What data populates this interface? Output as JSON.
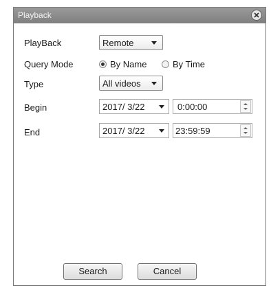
{
  "window": {
    "title": "Playback"
  },
  "form": {
    "playback": {
      "label": "PlayBack",
      "value": "Remote"
    },
    "query_mode": {
      "label": "Query Mode",
      "options": [
        {
          "label": "By Name",
          "selected": true
        },
        {
          "label": "By Time",
          "selected": false
        }
      ]
    },
    "type": {
      "label": "Type",
      "value": "All videos"
    },
    "begin": {
      "label": "Begin",
      "date": "2017/ 3/22",
      "time": "0:00:00"
    },
    "end": {
      "label": "End",
      "date": "2017/ 3/22",
      "time": "23:59:59"
    }
  },
  "buttons": {
    "search": "Search",
    "cancel": "Cancel"
  },
  "icons": {
    "close": "close-icon",
    "dropdown": "chevron-down-icon",
    "spinner": "spinner-icon"
  }
}
